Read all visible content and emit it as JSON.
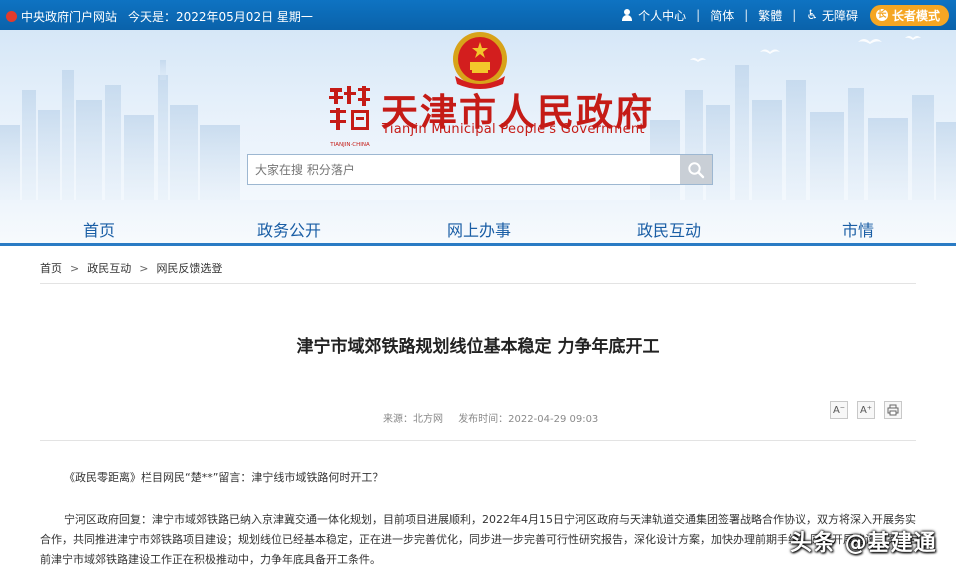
{
  "topbar": {
    "portal_link": "中央政府门户网站",
    "date_text": "今天是：2022年05月02日 星期一",
    "user_center": "个人中心",
    "simplified": "简体",
    "traditional": "繁體",
    "accessibility": "无障碍",
    "elder_mode": "长者模式",
    "elder_icon": "长"
  },
  "banner": {
    "title": "天津市人民政府",
    "subtitle": "Tianjin Municipal People's Government",
    "mark_text": "TIANJIN·CHINA",
    "search_placeholder": "大家在搜 积分落户"
  },
  "nav": {
    "items": [
      "首页",
      "政务公开",
      "网上办事",
      "政民互动",
      "市情"
    ]
  },
  "breadcrumb": {
    "items": [
      "首页",
      "政民互动",
      "网民反馈选登"
    ],
    "separator": ">"
  },
  "article": {
    "title": "津宁市域郊铁路规划线位基本稳定 力争年底开工",
    "source": "来源：北方网",
    "published": "发布时间：2022-04-29 09:03",
    "tools": [
      "A⁻",
      "A⁺",
      "print"
    ],
    "question": "《政民零距离》栏目网民“楚**”留言：津宁线市域铁路何时开工？",
    "answer": "宁河区政府回复：津宁市域郊铁路已纳入京津冀交通一体化规划，目前项目进展顺利，2022年4月15日宁河区政府与天津轨道交通集团签署战略合作协议，双方将深入开展务实合作，共同推进津宁市郊铁路项目建设；规划线位已经基本稳定，正在进一步完善优化，同步进一步完善可行性研究报告，深化设计方案，加快办理前期手续，同步开展建设方案。目前津宁市域郊铁路建设工作正在积极推动中，力争年底具备开工条件。"
  },
  "watermark": "头条 @基建通",
  "colors": {
    "topbar": "#0a62aa",
    "title_red": "#c51b16",
    "nav_text": "#1a5ea5",
    "elder_orange": "#f5a623"
  }
}
